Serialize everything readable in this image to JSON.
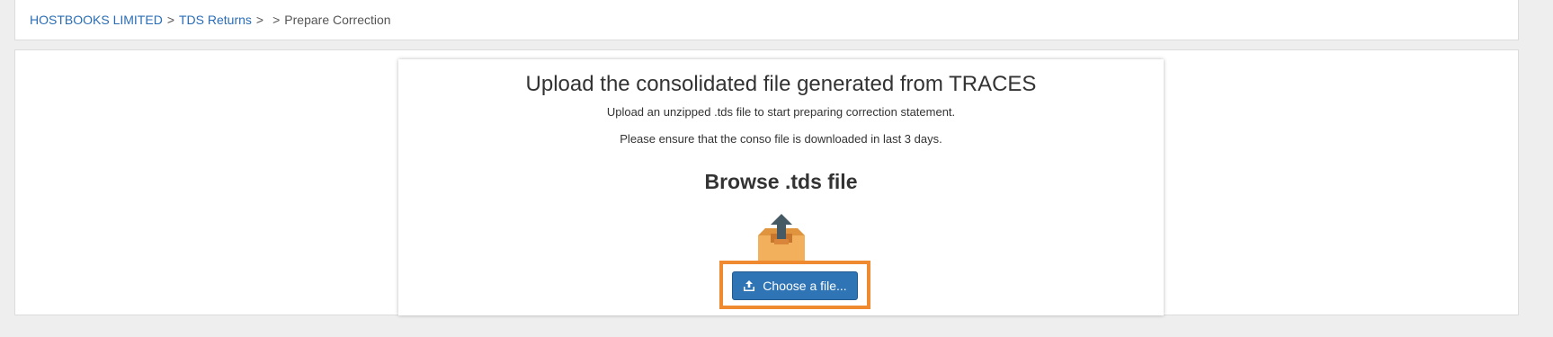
{
  "breadcrumb": {
    "company": "HOSTBOOKS LIMITED",
    "sep1": ">",
    "section": "TDS Returns",
    "sep2": ">",
    "sep3": ">",
    "current": "Prepare Correction"
  },
  "upload": {
    "title": "Upload the consolidated file generated from TRACES",
    "subtitle": "Upload an unzipped .tds file to start preparing correction statement.",
    "note": "Please ensure that the conso file is downloaded in last 3 days.",
    "browse_heading": "Browse .tds file",
    "button_label": "Choose a file...",
    "icons": {
      "illustration": "upload-box-icon",
      "button": "upload-icon"
    }
  },
  "colors": {
    "link": "#2a6db5",
    "button": "#2f74b5",
    "highlight": "#f08a30",
    "box": "#f2b05c",
    "arrow": "#455a64"
  }
}
